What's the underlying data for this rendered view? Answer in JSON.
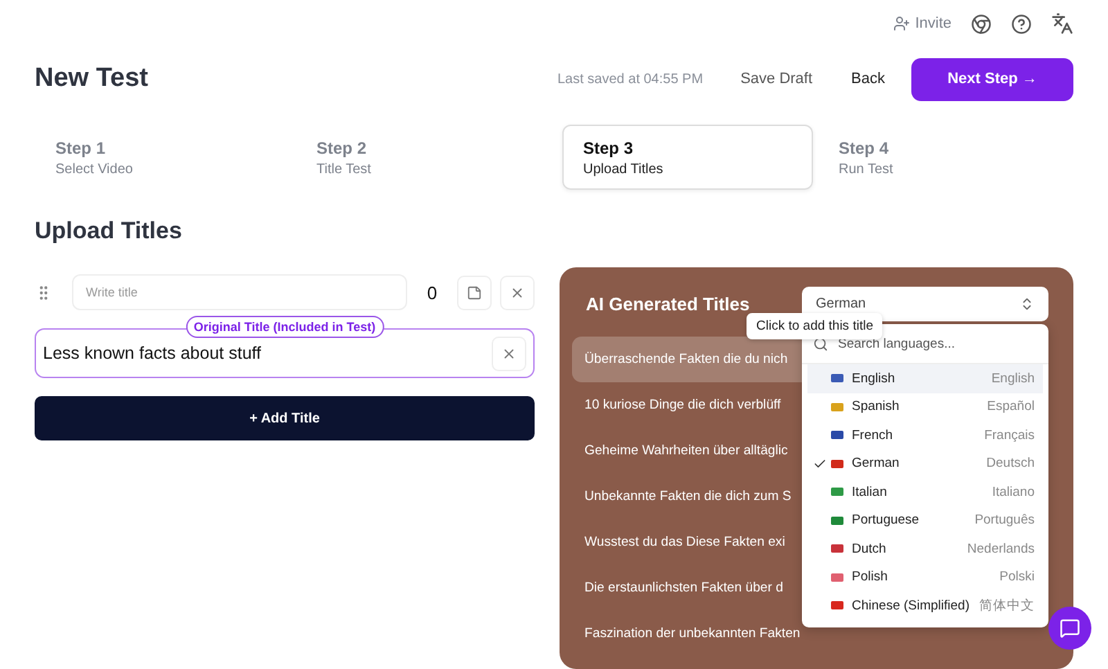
{
  "topbar": {
    "invite": "Invite"
  },
  "header": {
    "title": "New Test",
    "saved": "Last saved at 04:55 PM",
    "save_draft": "Save Draft",
    "back": "Back",
    "next": "Next Step →"
  },
  "steps": [
    {
      "title": "Step 1",
      "subtitle": "Select Video",
      "selected": false
    },
    {
      "title": "Step 2",
      "subtitle": "Title Test",
      "selected": false
    },
    {
      "title": "Step 3",
      "subtitle": "Upload Titles",
      "selected": true
    },
    {
      "title": "Step 4",
      "subtitle": "Run Test",
      "selected": false
    }
  ],
  "section_title": "Upload Titles",
  "new_title": {
    "placeholder": "Write title",
    "count": "0"
  },
  "original_title": {
    "badge": "Original Title (Included in Test)",
    "value": "Less known facts about stuff"
  },
  "add_title": "+ Add Title",
  "ai_panel": {
    "title": "AI Generated Titles",
    "language": "German",
    "tooltip": "Click to add this title",
    "titles": [
      {
        "text": "Überraschende Fakten die du nich",
        "hovered": true
      },
      {
        "text": "10 kuriose Dinge die dich verblüff",
        "hovered": false
      },
      {
        "text": "Geheime Wahrheiten über alltäglic",
        "hovered": false
      },
      {
        "text": "Unbekannte Fakten die dich zum S",
        "hovered": false
      },
      {
        "text": "Wusstest du das Diese Fakten exi",
        "hovered": false
      },
      {
        "text": "Die erstaunlichsten Fakten über d",
        "hovered": false
      },
      {
        "text": "Faszination der unbekannten Fakten",
        "hovered": false
      }
    ]
  },
  "language_menu": {
    "placeholder": "Search languages...",
    "languages": [
      {
        "name": "English",
        "native": "English",
        "color": "#3b5bb5",
        "selected": false,
        "highlighted": true
      },
      {
        "name": "Spanish",
        "native": "Español",
        "color": "#d9a21c",
        "selected": false,
        "highlighted": false
      },
      {
        "name": "French",
        "native": "Français",
        "color": "#2a4aa8",
        "selected": false,
        "highlighted": false
      },
      {
        "name": "German",
        "native": "Deutsch",
        "color": "#d12a1a",
        "selected": true,
        "highlighted": false
      },
      {
        "name": "Italian",
        "native": "Italiano",
        "color": "#2e9a46",
        "selected": false,
        "highlighted": false
      },
      {
        "name": "Portuguese",
        "native": "Português",
        "color": "#1f8a3a",
        "selected": false,
        "highlighted": false
      },
      {
        "name": "Dutch",
        "native": "Nederlands",
        "color": "#c8323a",
        "selected": false,
        "highlighted": false
      },
      {
        "name": "Polish",
        "native": "Polski",
        "color": "#e06070",
        "selected": false,
        "highlighted": false
      },
      {
        "name": "Chinese (Simplified)",
        "native": "简体中文",
        "color": "#d8281e",
        "selected": false,
        "highlighted": false
      }
    ]
  }
}
